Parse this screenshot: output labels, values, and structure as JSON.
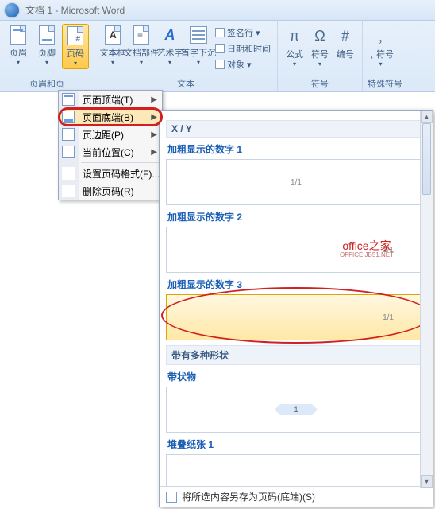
{
  "title": "文档 1 - Microsoft Word",
  "ribbon": {
    "group_hf": {
      "header": "页眉",
      "footer": "页脚",
      "pagenum": "页码",
      "label": "页眉和页"
    },
    "group_text": {
      "textbox": "文本框",
      "parts": "文档部件",
      "wordart": "艺术字",
      "dropcap": "首字下沉",
      "sig": "签名行",
      "date": "日期和时间",
      "obj": "对象",
      "label": "文本"
    },
    "group_sym": {
      "eq": "公式",
      "sym": "符号",
      "num": "编号",
      "label": "符号"
    },
    "group_special": {
      "sym": "﹐符号",
      "label": "特殊符号"
    }
  },
  "menu": {
    "top": "页面顶端(T)",
    "bottom": "页面底端(B)",
    "margin": "页边距(P)",
    "current": "当前位置(C)",
    "format": "设置页码格式(F)...",
    "remove": "删除页码(R)"
  },
  "gallery": {
    "head_xy": "X / Y",
    "items": [
      {
        "title": "加粗显示的数字 1",
        "sample": "1/1"
      },
      {
        "title": "加粗显示的数字 2",
        "sample": "1/1"
      },
      {
        "title": "加粗显示的数字 3",
        "sample": "1/1"
      }
    ],
    "watermark_main": "office之家",
    "watermark_sub": "OFFICE.JB51.NET",
    "head_shapes": "带有多种形状",
    "shape1": "带状物",
    "shape1_sample": "1",
    "stack": "堆叠纸张 1",
    "save_as": "将所选内容另存为页码(底端)(S)"
  }
}
